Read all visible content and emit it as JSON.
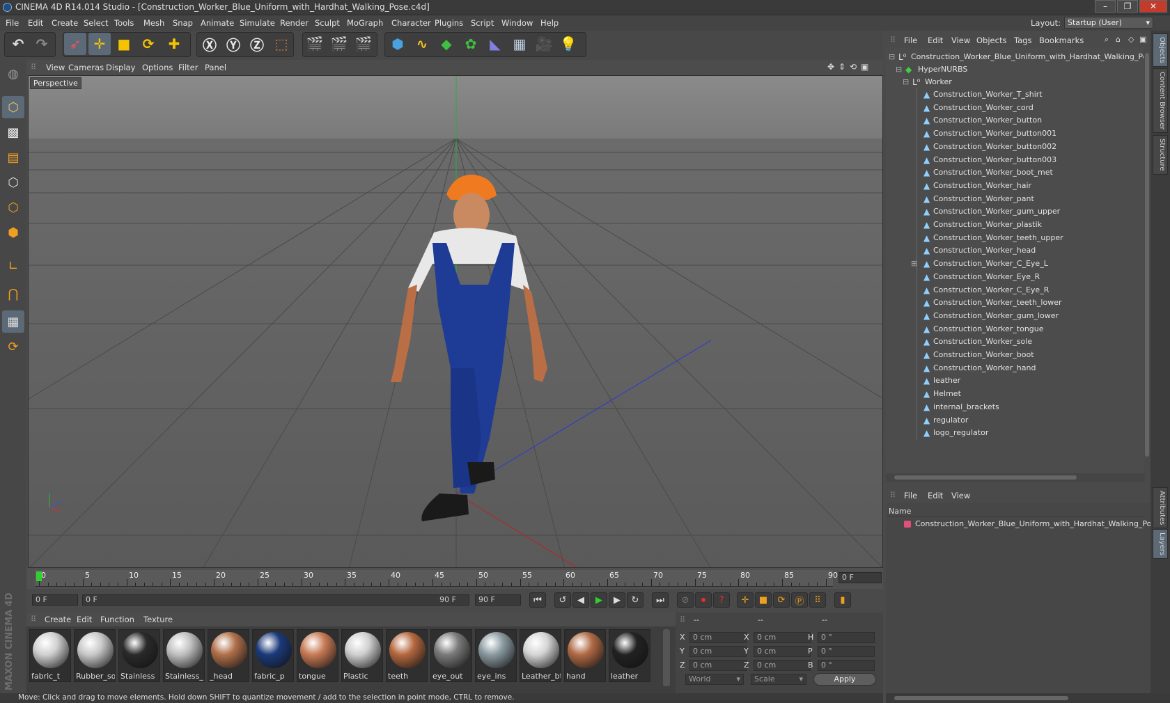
{
  "window": {
    "title": "CINEMA 4D R14.014 Studio - [Construction_Worker_Blue_Uniform_with_Hardhat_Walking_Pose.c4d]",
    "controls": [
      "–",
      "❐",
      "✕"
    ]
  },
  "menubar": {
    "items": [
      "File",
      "Edit",
      "Create",
      "Select",
      "Tools",
      "Mesh",
      "Snap",
      "Animate",
      "Simulate",
      "Render",
      "Sculpt",
      "MoGraph",
      "Character",
      "Plugins",
      "Script",
      "Window",
      "Help"
    ],
    "layout_label": "Layout:",
    "layout_value": "Startup (User)"
  },
  "viewport": {
    "menu": [
      "View",
      "Cameras",
      "Display",
      "Options",
      "Filter",
      "Panel"
    ],
    "label": "Perspective"
  },
  "timeline": {
    "ticks": [
      "0",
      "5",
      "10",
      "15",
      "20",
      "25",
      "30",
      "35",
      "40",
      "45",
      "50",
      "55",
      "60",
      "65",
      "70",
      "75",
      "80",
      "85",
      "90"
    ],
    "current_frame": "0 F",
    "start_field": "0 F",
    "range_start": "0 F",
    "range_end": "90 F",
    "end_field": "90 F"
  },
  "materials": {
    "menu": [
      "Create",
      "Edit",
      "Function",
      "Texture"
    ],
    "items": [
      {
        "label": "fabric_t",
        "color": "#d0d0d0"
      },
      {
        "label": "Rubber_so",
        "color": "#c8c8c8"
      },
      {
        "label": "Stainless",
        "color": "#2a2a2a"
      },
      {
        "label": "Stainless_",
        "color": "#bfbfbf"
      },
      {
        "label": "_head",
        "color": "#b0704a"
      },
      {
        "label": "fabric_p",
        "color": "#1b3a7a"
      },
      {
        "label": "tongue",
        "color": "#c87a55"
      },
      {
        "label": "Plastic",
        "color": "#cfcfcf"
      },
      {
        "label": "teeth",
        "color": "#b5683f"
      },
      {
        "label": "eye_out",
        "color": "#7a7a7a"
      },
      {
        "label": "eye_ins",
        "color": "#8a9aa0"
      },
      {
        "label": "Leather_bt",
        "color": "#d5d5d5"
      },
      {
        "label": "hand",
        "color": "#b06a45"
      },
      {
        "label": "leather",
        "color": "#222222"
      }
    ]
  },
  "coords": {
    "headers": [
      "--",
      "--",
      "--"
    ],
    "rows": [
      {
        "a": "X",
        "av": "0 cm",
        "b": "X",
        "bv": "0 cm",
        "c": "H",
        "cv": "0 °"
      },
      {
        "a": "Y",
        "av": "0 cm",
        "b": "Y",
        "bv": "0 cm",
        "c": "P",
        "cv": "0 °"
      },
      {
        "a": "Z",
        "av": "0 cm",
        "b": "Z",
        "bv": "0 cm",
        "c": "B",
        "cv": "0 °"
      }
    ],
    "mode": "World",
    "type": "Scale",
    "apply": "Apply"
  },
  "status": "Move: Click and drag to move elements. Hold down SHIFT to quantize movement / add to the selection in point mode, CTRL to remove.",
  "objects": {
    "menu": [
      "File",
      "Edit",
      "View",
      "Objects",
      "Tags",
      "Bookmarks"
    ],
    "root": "Construction_Worker_Blue_Uniform_with_Hardhat_Walking_Pose",
    "hypernurbs": "HyperNURBS",
    "worker": "Worker",
    "children": [
      "Construction_Worker_T_shirt",
      "Construction_Worker_cord",
      "Construction_Worker_button",
      "Construction_Worker_button001",
      "Construction_Worker_button002",
      "Construction_Worker_button003",
      "Construction_Worker_boot_met",
      "Construction_Worker_hair",
      "Construction_Worker_pant",
      "Construction_Worker_gum_upper",
      "Construction_Worker_plastik",
      "Construction_Worker_teeth_upper",
      "Construction_Worker_head",
      "Construction_Worker_C_Eye_L",
      "Construction_Worker_Eye_R",
      "Construction_Worker_C_Eye_R",
      "Construction_Worker_teeth_lower",
      "Construction_Worker_gum_lower",
      "Construction_Worker_tongue",
      "Construction_Worker_sole",
      "Construction_Worker_boot",
      "Construction_Worker_hand",
      "leather",
      "Helmet",
      "internal_brackets",
      "regulator",
      "logo_regulator"
    ]
  },
  "layers": {
    "menu": [
      "File",
      "Edit",
      "View"
    ],
    "column": "Name",
    "item": "Construction_Worker_Blue_Uniform_with_Hardhat_Walking_Pose",
    "item_color": "#e0507a"
  },
  "right_tabs": [
    "Objects",
    "Content Browser",
    "Structure",
    "Attributes",
    "Layers"
  ],
  "brand": "MAXON CINEMA 4D"
}
